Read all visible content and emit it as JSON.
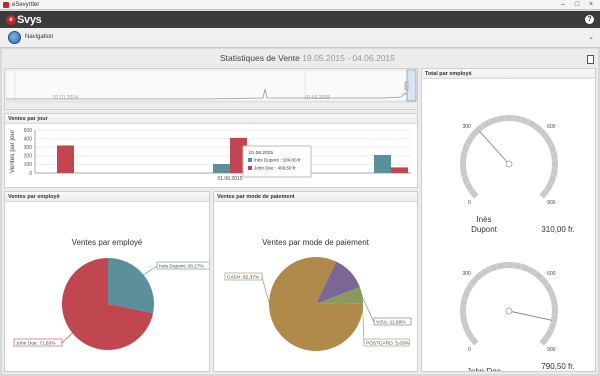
{
  "window": {
    "title": "eSevyrtter"
  },
  "app": {
    "logo_text": "Svys",
    "logo_mark": "e"
  },
  "nav": {
    "label": "Navigation"
  },
  "header": {
    "title": "Statistiques de Vente",
    "date_range": "19.05.2015 - 04.06.2015"
  },
  "timeline": {
    "labels": [
      "01.01.2014",
      "01.01.2015"
    ]
  },
  "panels": {
    "per_day": "Ventes par jour",
    "per_employee": "Ventes par employé",
    "per_payment": "Ventes par mode de paiement",
    "total_employee": "Total par employé"
  },
  "colors": {
    "teal": "#5b8f99",
    "red": "#c0474f",
    "gold": "#b08a4a",
    "purple": "#7b6795",
    "olive": "#8a9a5b"
  },
  "chart_data": [
    {
      "type": "bar",
      "title": "",
      "ylabel": "Ventes par jour",
      "ylim": [
        0,
        500
      ],
      "yticks": [
        0,
        100,
        200,
        300,
        400,
        500
      ],
      "categories": [
        "",
        "01.06.2015",
        ""
      ],
      "series": [
        {
          "name": "Inès Dupont",
          "color": "#5b8f99",
          "values": [
            0,
            104.0,
            210
          ]
        },
        {
          "name": "John Doe",
          "color": "#c0474f",
          "values": [
            320,
            408.5,
            65
          ]
        }
      ],
      "tooltip": {
        "title": "01.06.2015",
        "lines": [
          "Inès Dupont : 104,00 fr.",
          "John Doe : 408,50 fr."
        ]
      }
    },
    {
      "type": "pie",
      "title": "Ventes par employé",
      "slices": [
        {
          "label": "Inès Dupont: 28,17%",
          "value": 28.17,
          "color": "#5b8f99"
        },
        {
          "label": "John Doe: 71,83%",
          "value": 71.83,
          "color": "#c0474f"
        }
      ]
    },
    {
      "type": "pie",
      "title": "Ventes par mode de paiement",
      "slices": [
        {
          "label": "CASH: 82,37%",
          "value": 82.37,
          "color": "#b08a4a"
        },
        {
          "label": "VISA: 11,99%",
          "value": 11.99,
          "color": "#7b6795"
        },
        {
          "label": "POSTCARD: 5,63%",
          "value": 5.63,
          "color": "#8a9a5b"
        }
      ]
    },
    {
      "type": "gauge",
      "title": "Total par employé",
      "gauges": [
        {
          "name": "Inès Dupont",
          "value": 310.0,
          "value_text": "310,00 fr.",
          "min_label": "0",
          "mid_label": "300",
          "max_label": "600",
          "end_label": "900",
          "max": 900
        },
        {
          "name": "John Doe",
          "value": 790.5,
          "value_text": "790,50 fr.",
          "min_label": "0",
          "mid_label": "300",
          "max_label": "600",
          "end_label": "900",
          "max": 900
        }
      ]
    }
  ]
}
